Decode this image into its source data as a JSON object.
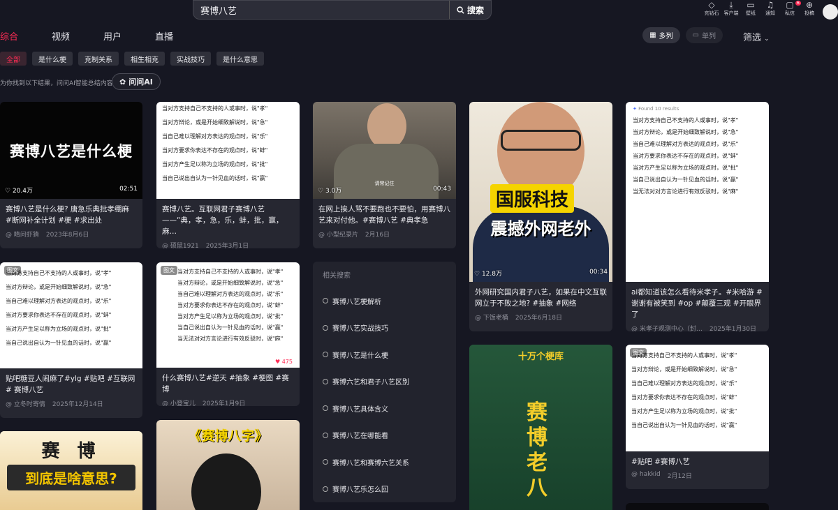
{
  "search": {
    "query": "赛博八艺",
    "button": "搜索"
  },
  "top_icons": [
    {
      "icon": "diamond-icon",
      "label": "充钻石"
    },
    {
      "icon": "download-icon",
      "label": "客户端"
    },
    {
      "icon": "wallpaper-icon",
      "label": "壁纸"
    },
    {
      "icon": "bell-icon",
      "label": "通知"
    },
    {
      "icon": "message-icon",
      "label": "私信",
      "badge": "6"
    },
    {
      "icon": "upload-icon",
      "label": "投稿"
    }
  ],
  "tabs": [
    {
      "label": "综合",
      "active": true
    },
    {
      "label": "视频"
    },
    {
      "label": "用户"
    },
    {
      "label": "直播"
    }
  ],
  "view": {
    "multi": "多列",
    "single": "单列",
    "filter": "筛选"
  },
  "chips": [
    "全部",
    "是什么梗",
    "克制关系",
    "相生相克",
    "实战技巧",
    "是什么意思"
  ],
  "hint": "为你找到以下结果，问问AI智能总结内容",
  "ai_button": "问问AI",
  "accent": "#fe2c55",
  "text_lines": [
    "当对方支持自己不支持的人或事时，说\"孝\"",
    "当对方辩论，或是开始细致解说时，说\"急\"",
    "当自己难以理解对方表达的观点时，说\"乐\"",
    "当对方要求你表达不存在的观点时，说\"蚌\"",
    "当对方产生足以称为立场的观点时，说\"批\"",
    "当自己说出自认为一针见血的话时，说\"赢\"",
    "当无法对对方言论进行有效反驳时，说\"麻\""
  ],
  "cards": {
    "c1": {
      "image_text": "赛博八艺是什么梗",
      "likes": "20.4万",
      "duration": "02:51",
      "title": "赛博八艺是什么梗? 唐急乐典批孝绷麻 #断网补全计划 #梗 #求出处",
      "author": "@ 睛问虾猜",
      "date": "2023年8月6日"
    },
    "c2": {
      "title": "赛博八艺。互联网君子赛博八艺——“典，孝，急，乐，蚌，批，赢，麻…",
      "author": "@ 硕鼠1921",
      "date": "2025年3月1日"
    },
    "c3": {
      "likes": "3.0万",
      "duration": "00:43",
      "subtitle": "请常记住",
      "title": "在网上挨人骂不要跑也不要怕，用赛博八艺来对付他。#赛博八艺 #典孝急",
      "author": "@ 小型纪录片",
      "date": "2月16日"
    },
    "c4": {
      "banner1": "国服科技",
      "banner2": "震撼外网老外",
      "likes": "12.8万",
      "duration": "00:34",
      "title": "外网研究国内君子八艺，如果在中文互联网立于不败之地? #抽象 #网络",
      "author": "@ 下饭老桶",
      "date": "2025年6月18日"
    },
    "c5": {
      "found": "Found 10 results",
      "title": "ai都知道该怎么看待米孝子。#米哈游 #谢谢有被笑到 #op #颠覆三观 #开眼界了",
      "author": "@ 米孝子观测中心（封…",
      "date": "2025年1月30日"
    },
    "c6": {
      "tag": "图文",
      "title": "贴吧糖豆人闹麻了#ylg #贴吧 #互联网# 赛博八艺",
      "author": "@ 立冬时寄情",
      "date": "2025年12月14日"
    },
    "c7": {
      "tag": "图文",
      "likes": "475",
      "title": "什么赛博八艺#逆天 #抽象 #梗图 #赛博",
      "author": "@ 小登宝儿",
      "date": "2025年1月9日"
    },
    "c8": {
      "tag": "图文",
      "title": "#贴吧 #赛博八艺",
      "author": "@ hakkid",
      "date": "2月12日"
    },
    "c9": {
      "line1": "赛 博",
      "line2": "到底是啥意思?"
    },
    "c10": {
      "banner": "《赛博八字》"
    },
    "c11": {
      "logo": "十万个梗库",
      "big": "赛博老八"
    }
  },
  "related": {
    "header": "相关搜索",
    "items": [
      "赛博八艺梗解析",
      "赛博八艺实战技巧",
      "赛博八艺是什么梗",
      "赛博六艺和君子八艺区别",
      "赛博八艺具体含义",
      "赛博八艺在哪能看",
      "赛博八艺和赛博六艺关系",
      "赛博八艺乐怎么回"
    ]
  }
}
